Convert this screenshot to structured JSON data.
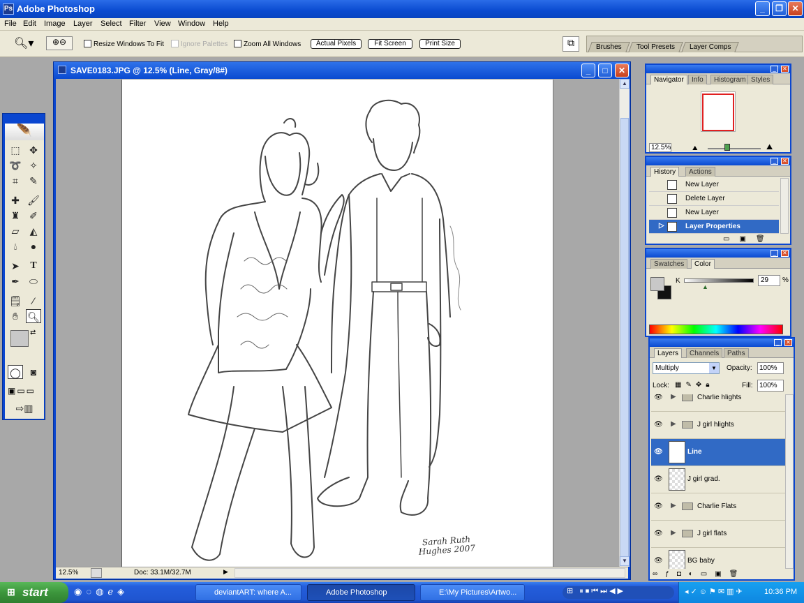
{
  "app": {
    "title": "Adobe Photoshop"
  },
  "menu": [
    "File",
    "Edit",
    "Image",
    "Layer",
    "Select",
    "Filter",
    "View",
    "Window",
    "Help"
  ],
  "options": {
    "resize_windows": "Resize Windows To Fit",
    "ignore_palettes": "Ignore Palettes",
    "zoom_all": "Zoom All Windows",
    "actual_pixels": "Actual Pixels",
    "fit_screen": "Fit Screen",
    "print_size": "Print Size"
  },
  "palette_well": [
    "Brushes",
    "Tool Presets",
    "Layer Comps"
  ],
  "document": {
    "title": "SAVE0183.JPG @ 12.5% (Line, Gray/8#)",
    "zoom": "12.5%",
    "doc_size": "Doc: 33.1M/32.7M",
    "signature": "Sarah Ruth Hughes 2007"
  },
  "navigator": {
    "tabs": [
      "Navigator",
      "Info",
      "Histogram",
      "Styles"
    ],
    "zoom": "12.5%"
  },
  "history": {
    "tabs": [
      "History",
      "Actions"
    ],
    "items": [
      "New Layer",
      "Delete Layer",
      "New Layer",
      "Layer Properties"
    ]
  },
  "color": {
    "tabs": [
      "Swatches",
      "Color"
    ],
    "channel": "K",
    "value": "29",
    "unit": "%"
  },
  "layers": {
    "tabs": [
      "Layers",
      "Channels",
      "Paths"
    ],
    "blend_mode": "Multiply",
    "opacity_label": "Opacity:",
    "opacity": "100%",
    "lock_label": "Lock:",
    "fill_label": "Fill:",
    "fill": "100%",
    "items": [
      "Charlie hlights",
      "J girl hlights",
      "Line",
      "J girl grad.",
      "Charlie Flats",
      "J girl flats",
      "BG baby"
    ]
  },
  "taskbar": {
    "start": "start",
    "tasks": [
      "deviantART: where A...",
      "Adobe Photoshop",
      "E:\\My Pictures\\Artwo..."
    ],
    "clock": "10:36 PM"
  },
  "icons": [
    "search-icon",
    "zoom-in-icon",
    "zoom-out-icon",
    "eye-icon",
    "folder-icon",
    "lock-icon",
    "brush-icon",
    "move-icon"
  ]
}
